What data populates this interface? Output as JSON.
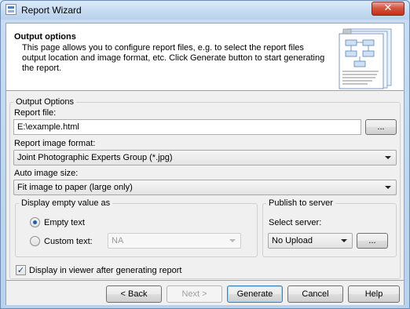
{
  "window": {
    "title": "Report Wizard",
    "close_label": "✕"
  },
  "header": {
    "title": "Output options",
    "description": "This page allows you to configure report files, e.g. to select the report files output location and image format, etc. Click Generate button to start generating the report."
  },
  "output_options": {
    "legend": "Output Options",
    "report_file": {
      "label": "Report file:",
      "value": "E:\\example.html",
      "browse_label": "..."
    },
    "image_format": {
      "label": "Report image format:",
      "selected": "Joint Photographic Experts Group (*.jpg)"
    },
    "auto_image_size": {
      "label": "Auto image size:",
      "selected": "Fit image to paper (large only)"
    }
  },
  "display_empty": {
    "legend": "Display empty value as",
    "empty_text_label": "Empty text",
    "empty_text_checked": true,
    "custom_text_label": "Custom text:",
    "custom_text_checked": false,
    "custom_text_value": "NA"
  },
  "publish": {
    "legend": "Publish to server",
    "select_label": "Select server:",
    "selected": "No Upload",
    "browse_label": "..."
  },
  "display_in_viewer": {
    "label": "Display in viewer after generating report",
    "checked": true
  },
  "buttons": {
    "back": "< Back",
    "next": "Next >",
    "generate": "Generate",
    "cancel": "Cancel",
    "help": "Help"
  },
  "colors": {
    "accent": "#3c7fb1",
    "radio_dot": "#1c5fa8",
    "close": "#c2301a"
  }
}
